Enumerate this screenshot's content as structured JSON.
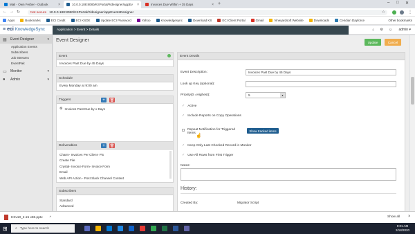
{
  "browser": {
    "tabs": [
      {
        "label": "Mail - Own Ferber - Outlook",
        "active": false,
        "color": "#0078d4"
      },
      {
        "label": "10.0.0.188:8080/KSPortal/#/designer/appEv",
        "active": true,
        "color": "#1f5d8f"
      },
      {
        "label": "Invoices Due Within + 35 Days",
        "active": false,
        "color": "#d93025"
      }
    ],
    "not_secure": "Not secure",
    "url": "10.0.0.188:8080/KSPortal/#/designer/appEventsDesigner",
    "bookmarks": [
      "Apps",
      "Bookmarks",
      "ECI Credit",
      "ECI KSDE",
      "Update ECI Password",
      "Yahoo",
      "Knowledgesync",
      "Download KS",
      "ECI Client Portal",
      "Gmail",
      "Vineyardsoft Website",
      "Downloads",
      "Ceridian Dayforce"
    ],
    "other_bookmarks": "Other bookmarks"
  },
  "app": {
    "logo_eci": "eci",
    "logo_product": "KnowledgeSync",
    "breadcrumb": "Application > Event > Details",
    "user": "admin"
  },
  "sidebar": {
    "event_designer": "Event Designer",
    "sub_items": [
      "Application Events",
      "Subscribers",
      "Job Streams",
      "EventPak"
    ],
    "monitor": "Monitor",
    "admin": "Admin"
  },
  "page": {
    "title": "Event Designer",
    "update": "Update",
    "cancel": "Cancel"
  },
  "left": {
    "event_head": "Event",
    "event_name": "Invoices Past Due by 45 Days",
    "schedule_head": "Schedule",
    "schedule_value": "Every Monday at 9:00 am",
    "triggers_head": "Triggers",
    "trigger_item": "Invoices Past Due by x Days",
    "deliverables_head": "Deliverables",
    "deliverables": [
      "Charm- Invoices Per Client- Pix",
      "Create File",
      "Crystal- Invoice Form- Invoice Form",
      "Email",
      "Web API Action - Post Slack Channel Content"
    ],
    "subscribers_head": "Subscribers",
    "subscribers": [
      "Standard",
      "Advanced"
    ]
  },
  "details": {
    "head": "Event Details",
    "desc_label": "Event Description:",
    "desc_value": "Invoices Past Due by 45 Days",
    "lookup_label": "Look up Key (optional):",
    "lookup_value": "",
    "priority_label": "Priority(0 =Highest):",
    "priority_value": "5",
    "active": "Active",
    "include_reports": "Include Reports on Copy Operations",
    "repeat_line1": "Repeat Notification for Triggered",
    "repeat_line2": "Items",
    "show_tracked": "Show tracked items",
    "keep_only": "Keep Only Last Checked Record in Monitor",
    "use_all_rows": "Use All Rows from First Trigger",
    "notes_label": "Notes:",
    "history_head": "History:",
    "created_by_label": "Created By:",
    "created_by_value": "Migrator Script"
  },
  "downloads": {
    "file": "KSv10_2.15 x86.pptx",
    "show_all": "Show all"
  },
  "taskbar": {
    "search": "Type here to search",
    "time": "9:01 AM",
    "date": "2/18/2020"
  }
}
